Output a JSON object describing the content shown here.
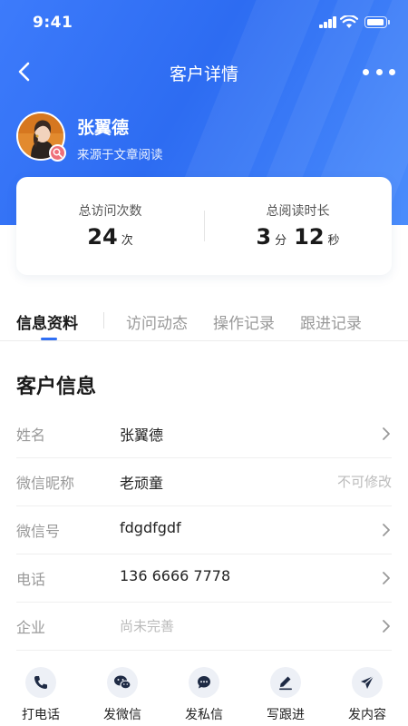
{
  "status_bar": {
    "time": "9:41"
  },
  "nav": {
    "title": "客户详情"
  },
  "profile": {
    "name": "张翼德",
    "source": "来源于文章阅读"
  },
  "stats": {
    "visits": {
      "label": "总访问次数",
      "value": "24",
      "unit": "次"
    },
    "read_time": {
      "label": "总阅读时长",
      "minutes": "3",
      "minutes_unit": "分",
      "seconds": "12",
      "seconds_unit": "秒"
    }
  },
  "tabs": [
    {
      "label": "信息资料",
      "active": true
    },
    {
      "label": "访问动态",
      "active": false
    },
    {
      "label": "操作记录",
      "active": false
    },
    {
      "label": "跟进记录",
      "active": false
    }
  ],
  "customer_info": {
    "title": "客户信息",
    "rows": [
      {
        "label": "姓名",
        "value": "张翼德"
      },
      {
        "label": "微信昵称",
        "value": "老顽童",
        "note": "不可修改"
      },
      {
        "label": "微信号",
        "value": "fdgdfgdf"
      },
      {
        "label": "电话",
        "value": "136 6666 7778"
      },
      {
        "label": "企业",
        "value": "尚未完善"
      }
    ]
  },
  "bottom_actions": [
    {
      "label": "打电话",
      "icon": "phone-icon"
    },
    {
      "label": "发微信",
      "icon": "wechat-icon"
    },
    {
      "label": "发私信",
      "icon": "message-icon"
    },
    {
      "label": "写跟进",
      "icon": "pen-icon"
    },
    {
      "label": "发内容",
      "icon": "send-icon"
    }
  ],
  "colors": {
    "primary": "#2f6ff4",
    "header_gradient_start": "#3d7bfb",
    "header_gradient_end": "#4b8dfc",
    "badge": "#ee6f7a"
  }
}
